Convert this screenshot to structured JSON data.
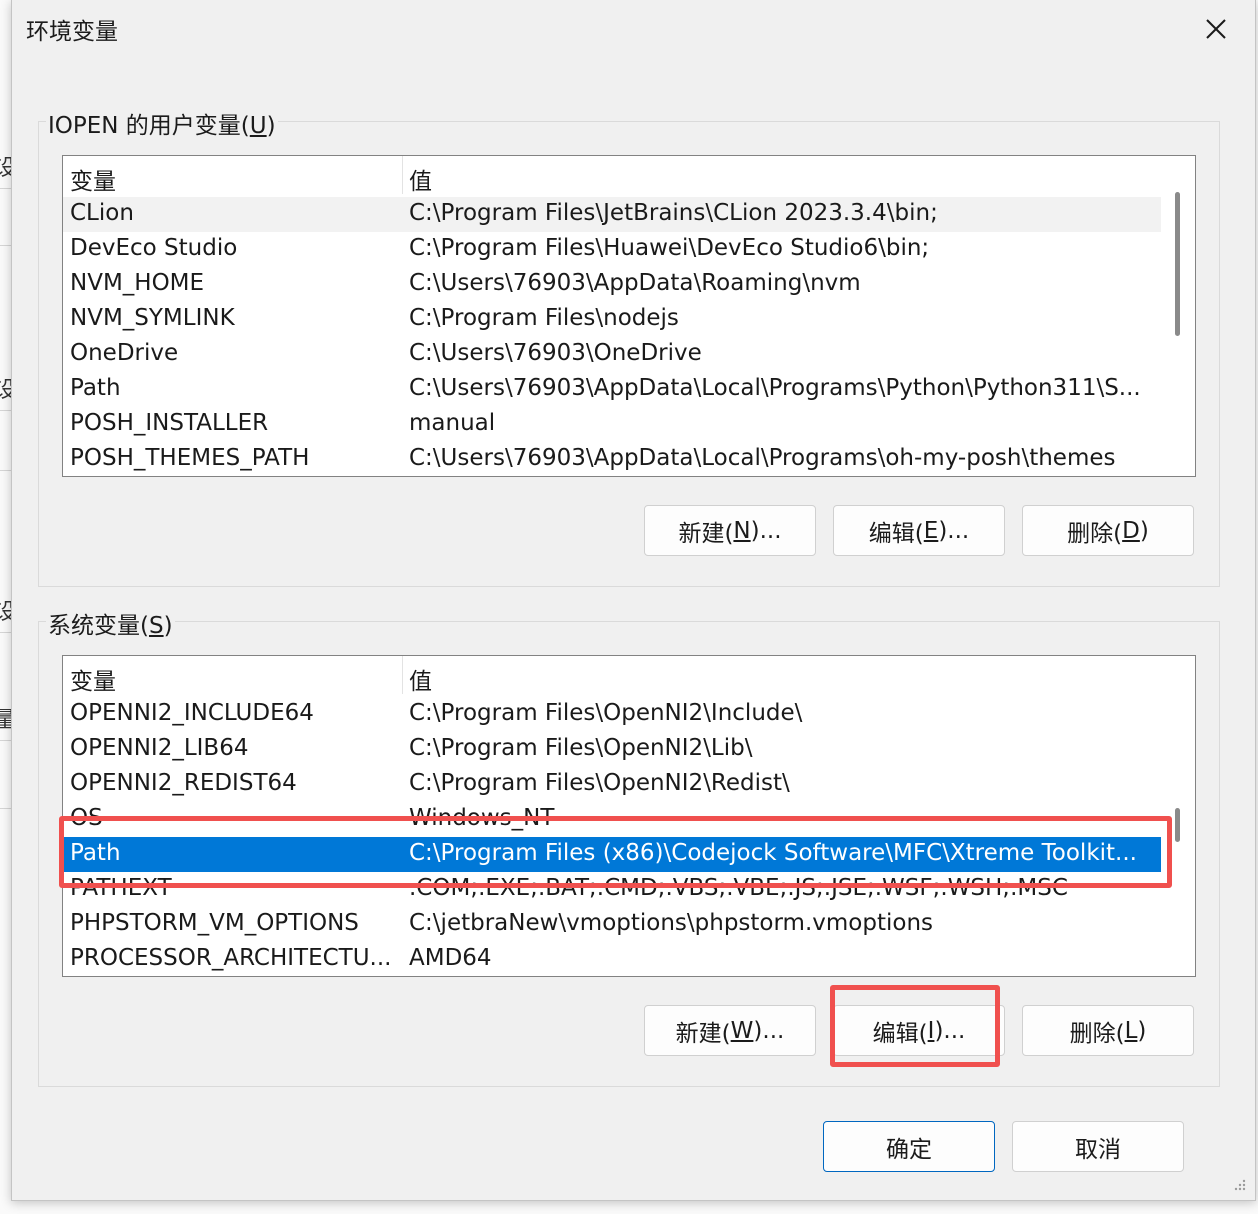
{
  "window": {
    "title": "环境变量",
    "close_icon": "close-icon"
  },
  "user_vars": {
    "group_label_prefix": "IOPEN 的用户变量(",
    "group_label_key": "U",
    "group_label_suffix": ")",
    "columns": [
      "变量",
      "值"
    ],
    "rows": [
      {
        "name": "CLion",
        "value": "C:\\Program Files\\JetBrains\\CLion 2023.3.4\\bin;"
      },
      {
        "name": "DevEco Studio",
        "value": "C:\\Program Files\\Huawei\\DevEco Studio6\\bin;"
      },
      {
        "name": "NVM_HOME",
        "value": "C:\\Users\\76903\\AppData\\Roaming\\nvm"
      },
      {
        "name": "NVM_SYMLINK",
        "value": "C:\\Program Files\\nodejs"
      },
      {
        "name": "OneDrive",
        "value": "C:\\Users\\76903\\OneDrive"
      },
      {
        "name": "Path",
        "value": "C:\\Users\\76903\\AppData\\Local\\Programs\\Python\\Python311\\S..."
      },
      {
        "name": "POSH_INSTALLER",
        "value": "manual"
      },
      {
        "name": "POSH_THEMES_PATH",
        "value": "C:\\Users\\76903\\AppData\\Local\\Programs\\oh-my-posh\\themes"
      }
    ],
    "buttons": {
      "new": {
        "prefix": "新建(",
        "key": "N",
        "suffix": ")..."
      },
      "edit": {
        "prefix": "编辑(",
        "key": "E",
        "suffix": ")..."
      },
      "delete": {
        "prefix": "删除(",
        "key": "D",
        "suffix": ")"
      }
    }
  },
  "system_vars": {
    "group_label_prefix": "系统变量(",
    "group_label_key": "S",
    "group_label_suffix": ")",
    "columns": [
      "变量",
      "值"
    ],
    "rows": [
      {
        "name": "OPENNI2_INCLUDE64",
        "value": "C:\\Program Files\\OpenNI2\\Include\\"
      },
      {
        "name": "OPENNI2_LIB64",
        "value": "C:\\Program Files\\OpenNI2\\Lib\\"
      },
      {
        "name": "OPENNI2_REDIST64",
        "value": "C:\\Program Files\\OpenNI2\\Redist\\"
      },
      {
        "name": "OS",
        "value": "Windows_NT"
      },
      {
        "name": "Path",
        "value": "C:\\Program Files (x86)\\Codejock Software\\MFC\\Xtreme Toolkit..."
      },
      {
        "name": "PATHEXT",
        "value": ".COM;.EXE;.BAT;.CMD;.VBS;.VBE;.JS;.JSE;.WSF;.WSH;.MSC"
      },
      {
        "name": "PHPSTORM_VM_OPTIONS",
        "value": "C:\\jetbraNew\\vmoptions\\phpstorm.vmoptions"
      },
      {
        "name": "PROCESSOR_ARCHITECTU...",
        "value": "AMD64"
      }
    ],
    "selected_row": "Path",
    "buttons": {
      "new": {
        "prefix": "新建(",
        "key": "W",
        "suffix": ")..."
      },
      "edit": {
        "prefix": "编辑(",
        "key": "I",
        "suffix": ")..."
      },
      "delete": {
        "prefix": "删除(",
        "key": "L",
        "suffix": ")"
      }
    }
  },
  "footer": {
    "ok_label": "确定",
    "cancel_label": "取消"
  },
  "colors": {
    "selection": "#0078d7",
    "annotation_red": "#f0504e",
    "default_button_border": "#0067c0"
  },
  "background_glyphs": [
    "设",
    "设",
    "设",
    "量"
  ]
}
